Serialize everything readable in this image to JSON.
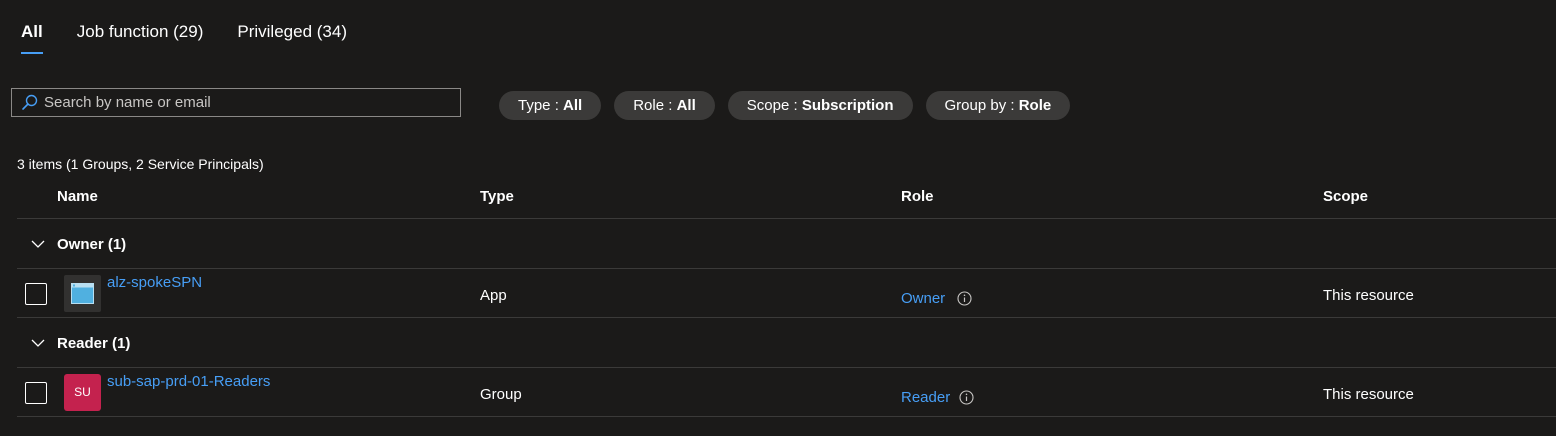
{
  "tabs": [
    {
      "label": "All",
      "active": true
    },
    {
      "label": "Job function (29)",
      "active": false
    },
    {
      "label": "Privileged (34)",
      "active": false
    }
  ],
  "search": {
    "placeholder": "Search by name or email",
    "value": "",
    "icon": "search-icon"
  },
  "filters": [
    {
      "key": "Type",
      "value": "All"
    },
    {
      "key": "Role",
      "value": "All"
    },
    {
      "key": "Scope",
      "value": "Subscription"
    },
    {
      "key": "Group by",
      "value": "Role"
    }
  ],
  "summary": "3 items (1 Groups, 2 Service Principals)",
  "table": {
    "columns": [
      "Name",
      "Type",
      "Role",
      "Scope"
    ],
    "groups": [
      {
        "label": "Owner (1)",
        "rows": [
          {
            "name": "alz-spokeSPN",
            "type": "App",
            "role": "Owner",
            "scope": "This resource",
            "icon": "app-icon"
          }
        ]
      },
      {
        "label": "Reader (1)",
        "rows": [
          {
            "name": "sub-sap-prd-01-Readers",
            "type": "Group",
            "role": "Reader",
            "scope": "This resource",
            "avatar": "SU"
          }
        ]
      }
    ]
  },
  "colors": {
    "background": "#1b1a19",
    "link": "#479ef5",
    "pill": "#3b3a39",
    "avatar": "#c4224e",
    "tab_indicator": "#479ef5"
  }
}
